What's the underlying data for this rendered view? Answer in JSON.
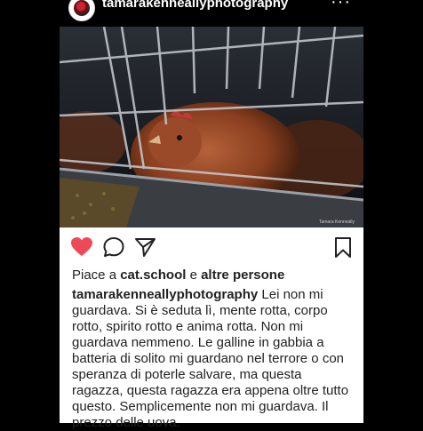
{
  "post": {
    "username": "tamarakenneallyphotography",
    "more_label": "···",
    "watermark": "Tamara Kenneally"
  },
  "likes": {
    "prefix": "Piace a",
    "user": "cat.school",
    "conjunction": "e",
    "others": "altre persone"
  },
  "caption": {
    "username": "tamarakenneallyphotography",
    "text": "Lei non mi guardava. Si è seduta lì, mente rotta, corpo rotto, spirito rotto e anima rotta. Non mi guardava nemmeno. Le galline in gabbia a batteria di solito mi guardano nel terrore o con speranza di poterle salvare, ma questa ragazza, questa ragazza era appena oltre tutto questo. Semplicemente non mi guardava. Il prezzo delle uova."
  },
  "colors": {
    "like_red": "#ed4956",
    "background": "#000000",
    "panel": "#ffffff",
    "text": "#222222"
  },
  "icons": [
    "heart-icon",
    "comment-icon",
    "share-icon",
    "bookmark-icon",
    "more-icon"
  ]
}
